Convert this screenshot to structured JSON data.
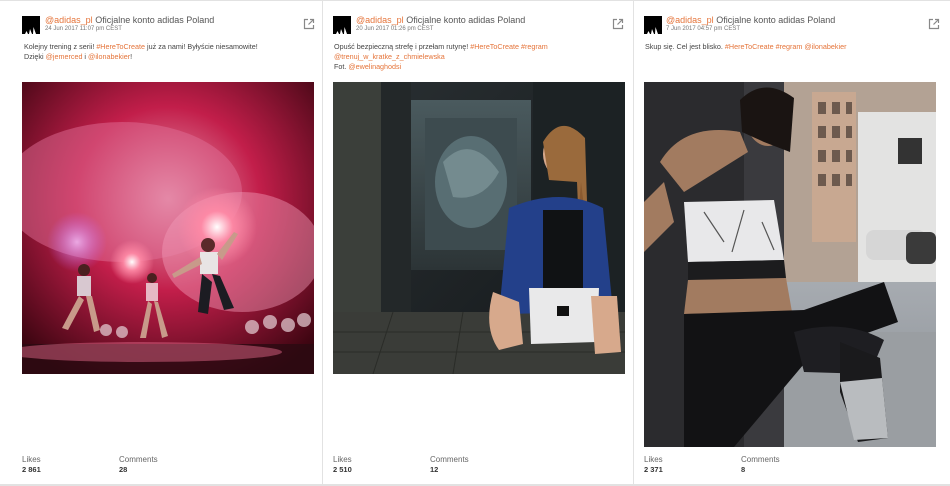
{
  "posts": [
    {
      "handle": "@adidas_pl",
      "account": "Oficjalne konto adidas Poland",
      "date": "24 Jun 2017 11:07 pm CEST",
      "caption_line1_text": "Kolejny trening z serii! ",
      "caption_line1_tag": "#HereToCreate",
      "caption_line1_rest": " już za nami! Byłyście niesamowite!",
      "caption_line2_text": "Dzięki ",
      "caption_line2_tag1": "@jemerced",
      "caption_line2_mid": " i ",
      "caption_line2_tag2": "@ilonabekier",
      "caption_line2_rest": "!",
      "likes_label": "Likes",
      "likes_value": "2 861",
      "comments_label": "Comments",
      "comments_value": "28"
    },
    {
      "handle": "@adidas_pl",
      "account": "Oficjalne konto adidas Poland",
      "date": "20 Jun 2017 01:26 pm CEST",
      "caption_line1_text": "Opuść bezpieczną strefę i przełam rutynę! ",
      "caption_line1_tag": "#HereToCreate #regram",
      "caption_line2_tag": "@trenuj_w_kratke_z_chmielewska",
      "caption_line3_text": "Fot. ",
      "caption_line3_tag": "@ewelinaghodsi",
      "likes_label": "Likes",
      "likes_value": "2 510",
      "comments_label": "Comments",
      "comments_value": "12"
    },
    {
      "handle": "@adidas_pl",
      "account": "Oficjalne konto adidas Poland",
      "date": "7 Jun 2017 04:57 pm CEST",
      "caption_line1_text": "Skup się. Cel jest blisko. ",
      "caption_line1_tag": "#HereToCreate #regram @ilonabekier",
      "likes_label": "Likes",
      "likes_value": "2 371",
      "comments_label": "Comments",
      "comments_value": "8"
    }
  ],
  "colors": {
    "accent": "#e5743a",
    "card_bg": "#ffffff",
    "divider": "#e2e2e2"
  },
  "icons": {
    "avatar": "adidas-logo-icon",
    "open": "external-link-icon"
  }
}
